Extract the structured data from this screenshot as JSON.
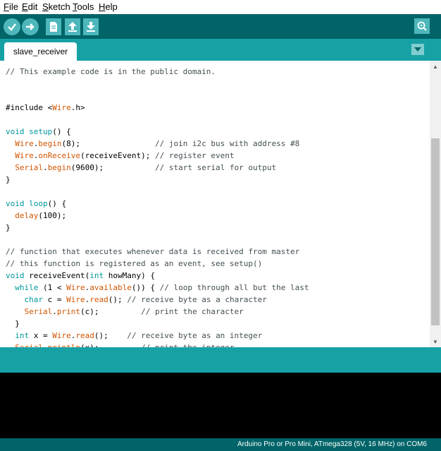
{
  "menu": [
    "File",
    "Edit",
    "Sketch",
    "Tools",
    "Help"
  ],
  "toolbar": {
    "icons": [
      "verify-icon",
      "upload-icon",
      "new-icon",
      "open-icon",
      "save-icon",
      "serial-monitor-icon"
    ],
    "accent": "#006468",
    "button_color": "#4db7bb"
  },
  "tab": {
    "label": "slave_receiver"
  },
  "code": [
    [
      {
        "t": "// This example code is in the public domain.",
        "c": "cm"
      }
    ],
    [],
    [],
    [
      {
        "t": "#include <"
      },
      {
        "t": "Wire",
        "c": "fn"
      },
      {
        "t": ".h>"
      }
    ],
    [],
    [
      {
        "t": "void",
        "c": "kw"
      },
      {
        "t": " "
      },
      {
        "t": "setup",
        "c": "kw"
      },
      {
        "t": "() {"
      }
    ],
    [
      {
        "t": "  "
      },
      {
        "t": "Wire",
        "c": "fn"
      },
      {
        "t": "."
      },
      {
        "t": "begin",
        "c": "fn"
      },
      {
        "t": "(8);                "
      },
      {
        "t": "// join i2c bus with address #8",
        "c": "cm"
      }
    ],
    [
      {
        "t": "  "
      },
      {
        "t": "Wire",
        "c": "fn"
      },
      {
        "t": "."
      },
      {
        "t": "onReceive",
        "c": "fn"
      },
      {
        "t": "(receiveEvent); "
      },
      {
        "t": "// register event",
        "c": "cm"
      }
    ],
    [
      {
        "t": "  "
      },
      {
        "t": "Serial",
        "c": "fn"
      },
      {
        "t": "."
      },
      {
        "t": "begin",
        "c": "fn"
      },
      {
        "t": "(9600);           "
      },
      {
        "t": "// start serial for output",
        "c": "cm"
      }
    ],
    [
      {
        "t": "}"
      }
    ],
    [],
    [
      {
        "t": "void",
        "c": "kw"
      },
      {
        "t": " "
      },
      {
        "t": "loop",
        "c": "kw"
      },
      {
        "t": "() {"
      }
    ],
    [
      {
        "t": "  "
      },
      {
        "t": "delay",
        "c": "fn"
      },
      {
        "t": "(100);"
      }
    ],
    [
      {
        "t": "}"
      }
    ],
    [],
    [
      {
        "t": "// function that executes whenever data is received from master",
        "c": "cm"
      }
    ],
    [
      {
        "t": "// this function is registered as an event, see setup()",
        "c": "cm"
      }
    ],
    [
      {
        "t": "void",
        "c": "kw"
      },
      {
        "t": " receiveEvent("
      },
      {
        "t": "int",
        "c": "kw"
      },
      {
        "t": " howMany) {"
      }
    ],
    [
      {
        "t": "  "
      },
      {
        "t": "while",
        "c": "kw"
      },
      {
        "t": " (1 < "
      },
      {
        "t": "Wire",
        "c": "fn"
      },
      {
        "t": "."
      },
      {
        "t": "available",
        "c": "fn"
      },
      {
        "t": "()) { "
      },
      {
        "t": "// loop through all but the last",
        "c": "cm"
      }
    ],
    [
      {
        "t": "    "
      },
      {
        "t": "char",
        "c": "kw"
      },
      {
        "t": " c = "
      },
      {
        "t": "Wire",
        "c": "fn"
      },
      {
        "t": "."
      },
      {
        "t": "read",
        "c": "fn"
      },
      {
        "t": "(); "
      },
      {
        "t": "// receive byte as a character",
        "c": "cm"
      }
    ],
    [
      {
        "t": "    "
      },
      {
        "t": "Serial",
        "c": "fn"
      },
      {
        "t": "."
      },
      {
        "t": "print",
        "c": "fn"
      },
      {
        "t": "(c);         "
      },
      {
        "t": "// print the character",
        "c": "cm"
      }
    ],
    [
      {
        "t": "  }"
      }
    ],
    [
      {
        "t": "  "
      },
      {
        "t": "int",
        "c": "kw"
      },
      {
        "t": " x = "
      },
      {
        "t": "Wire",
        "c": "fn"
      },
      {
        "t": "."
      },
      {
        "t": "read",
        "c": "fn"
      },
      {
        "t": "();    "
      },
      {
        "t": "// receive byte as an integer",
        "c": "cm"
      }
    ],
    [
      {
        "t": "  "
      },
      {
        "t": "Serial",
        "c": "fn"
      },
      {
        "t": "."
      },
      {
        "t": "println",
        "c": "fn"
      },
      {
        "t": "(x);         "
      },
      {
        "t": "// print the integer",
        "c": "cm"
      }
    ]
  ],
  "status": {
    "board": "Arduino Pro or Pro Mini, ATmega328 (5V, 16 MHz) on COM6"
  }
}
